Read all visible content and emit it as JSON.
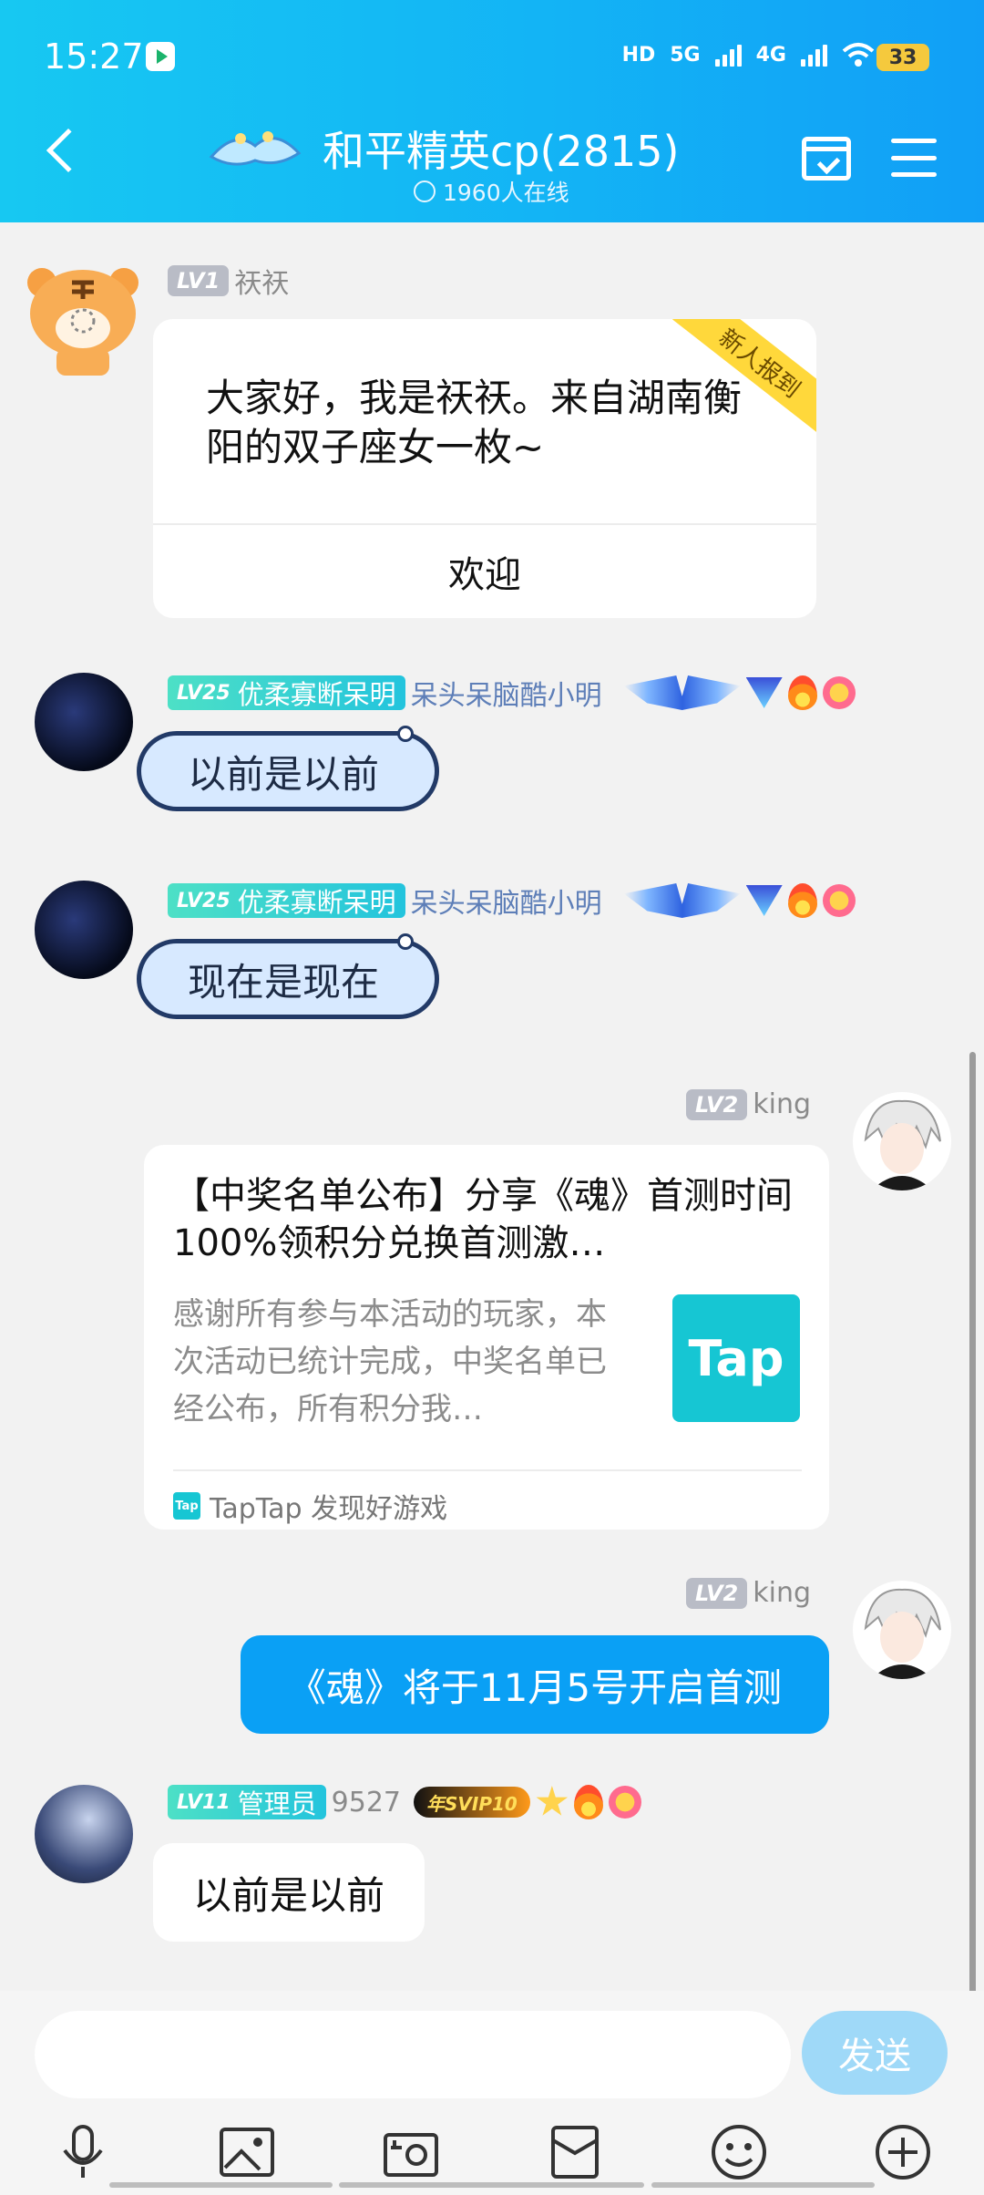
{
  "status_bar": {
    "time": "15:27",
    "hd_label": "HD",
    "net1": "5G",
    "net2": "4G",
    "battery": "33"
  },
  "header": {
    "title": "和平精英cp(2815)",
    "online": "1960人在线"
  },
  "messages": [
    {
      "type": "intro-card",
      "level": "LV1",
      "sender": "祆祆",
      "text": "大家好，我是祆祆。来自湖南衡阳的双子座女一枚~",
      "ribbon": "新人报到",
      "action": "欢迎"
    },
    {
      "type": "whale",
      "level": "LV25",
      "title": "优柔寡断呆明",
      "sender": "呆头呆脑酷小明",
      "text": "以前是以前"
    },
    {
      "type": "whale",
      "level": "LV25",
      "title": "优柔寡断呆明",
      "sender": "呆头呆脑酷小明",
      "text": "现在是现在"
    },
    {
      "type": "share-card",
      "level": "LV2",
      "sender": "king",
      "title": "【中奖名单公布】分享《魂》首测时间 100%领积分兑换首测激…",
      "desc": "感谢所有参与本活动的玩家，本次活动已统计完成，中奖名单已经公布，所有积分我…",
      "thumb": "Tap",
      "source_icon": "Tap",
      "source": "TapTap 发现好游戏"
    },
    {
      "type": "self-text",
      "level": "LV2",
      "sender": "king",
      "text": "《魂》将于11月5号开启首测"
    },
    {
      "type": "text",
      "level": "LV11",
      "title": "管理员",
      "sender": "9527",
      "vip": "年SVIP10",
      "text": "以前是以前"
    }
  ],
  "composer": {
    "send_label": "发送",
    "tools": [
      "mic-icon",
      "image-icon",
      "camera-icon",
      "red-packet-icon",
      "emoji-icon",
      "plus-icon"
    ]
  },
  "colors": {
    "header_from": "#17c8f2",
    "header_to": "#119ff6",
    "self_bubble": "#0aa0f5",
    "send_button": "#9fd9f8",
    "ribbon": "#ffd83b"
  }
}
